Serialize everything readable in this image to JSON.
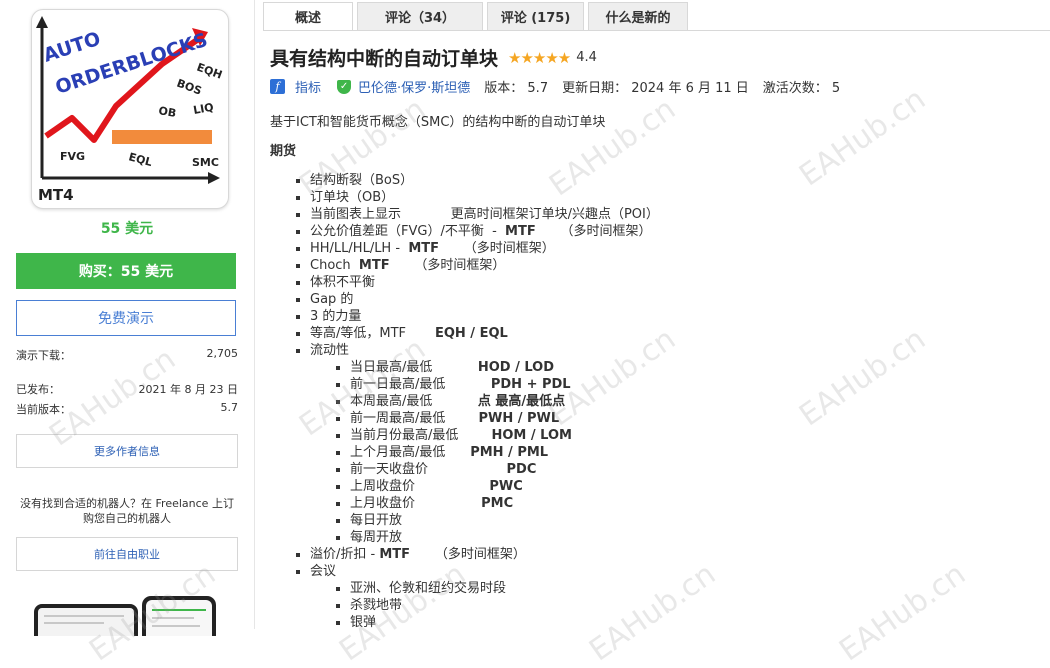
{
  "sidebar": {
    "logo_text": [
      "AUTO",
      "ORDERBLOCKS",
      "EQH",
      "BOS",
      "OB",
      "LIQ",
      "FVG",
      "EQL",
      "SMC",
      "MT4"
    ],
    "price": "55 美元",
    "buy_label": "购买：55 美元",
    "demo_label": "免费演示",
    "demo_downloads_label": "演示下载：",
    "demo_downloads_value": "2,705",
    "published_label": "已发布：",
    "published_value": "2021 年 8 月 23 日",
    "version_label": "当前版本：",
    "version_value": "5.7",
    "more_author_info": "更多作者信息",
    "freelance_text": "没有找到合适的机器人？在 Freelance 上订购您自己的机器人",
    "go_freelance": "前往自由职业"
  },
  "tabs": [
    {
      "label": "概述",
      "active": true
    },
    {
      "label": "评论（34）",
      "active": false
    },
    {
      "label": "评论 (175)",
      "active": false
    },
    {
      "label": "什么是新的",
      "active": false
    }
  ],
  "product": {
    "title": "具有结构中断的自动订单块",
    "stars": "★★★★★",
    "rating": "4.4",
    "category": "指标",
    "author": "巴伦德·保罗·斯坦德",
    "version_text": "版本： 5.7",
    "updated_text": "更新日期： 2024 年 6 月 11 日",
    "activations_text": "激活次数： 5"
  },
  "description": {
    "intro": "基于ICT和智能货币概念（SMC）的结构中断的自动订单块",
    "heading": "期货",
    "items": [
      {
        "level": 1,
        "text": "结构断裂（BoS）"
      },
      {
        "level": 1,
        "text": "订单块（OB）"
      },
      {
        "level": 1,
        "text": "当前图表上显示            更高时间框架订单块/兴趣点（POI）"
      },
      {
        "level": 1,
        "text": "公允价值差距（FVG）/不平衡  -  ",
        "bold": "MTF",
        "after": "      （多时间框架）"
      },
      {
        "level": 1,
        "text": "HH/LL/HL/LH -  ",
        "bold": "MTF",
        "after": "      （多时间框架）"
      },
      {
        "level": 1,
        "text": "Choch  ",
        "bold": "MTF",
        "after": "      （多时间框架）"
      },
      {
        "level": 1,
        "text": "体积不平衡"
      },
      {
        "level": 1,
        "text": "Gap 的"
      },
      {
        "level": 1,
        "text": "3 的力量"
      },
      {
        "level": 1,
        "text": "等高/等低，MTF       ",
        "bold": "EQH / EQL"
      },
      {
        "level": 1,
        "text": "流动性"
      },
      {
        "level": 2,
        "text": "当日最高/最低           ",
        "bold": "HOD / LOD"
      },
      {
        "level": 2,
        "text": "前一日最高/最低           ",
        "bold": "PDH + PDL"
      },
      {
        "level": 2,
        "text": "本周最高/最低           ",
        "bold": "点 最高/最低点"
      },
      {
        "level": 2,
        "text": "前一周最高/最低        ",
        "bold": "PWH / PWL"
      },
      {
        "level": 2,
        "text": "当前月份最高/最低        ",
        "bold": "HOM / LOM"
      },
      {
        "level": 2,
        "text": "上个月最高/最低      ",
        "bold": "PMH / PML"
      },
      {
        "level": 2,
        "text": "前一天收盘价                   ",
        "bold": "PDC"
      },
      {
        "level": 2,
        "text": "上周收盘价                  ",
        "bold": "PWC"
      },
      {
        "level": 2,
        "text": "上月收盘价                ",
        "bold": "PMC"
      },
      {
        "level": 2,
        "text": "每日开放"
      },
      {
        "level": 2,
        "text": "每周开放"
      },
      {
        "level": 1,
        "text": "溢价/折扣 - ",
        "bold": "MTF",
        "after": "      （多时间框架）"
      },
      {
        "level": 1,
        "text": "会议"
      },
      {
        "level": 2,
        "text": "亚洲、伦敦和纽约交易时段"
      },
      {
        "level": 2,
        "text": "杀戮地带"
      },
      {
        "level": 2,
        "text": "银弹"
      }
    ]
  },
  "watermark": "EAHub.cn",
  "colors": {
    "green": "#3fb64a",
    "blue": "#2d60b5",
    "star": "#f5a623"
  }
}
